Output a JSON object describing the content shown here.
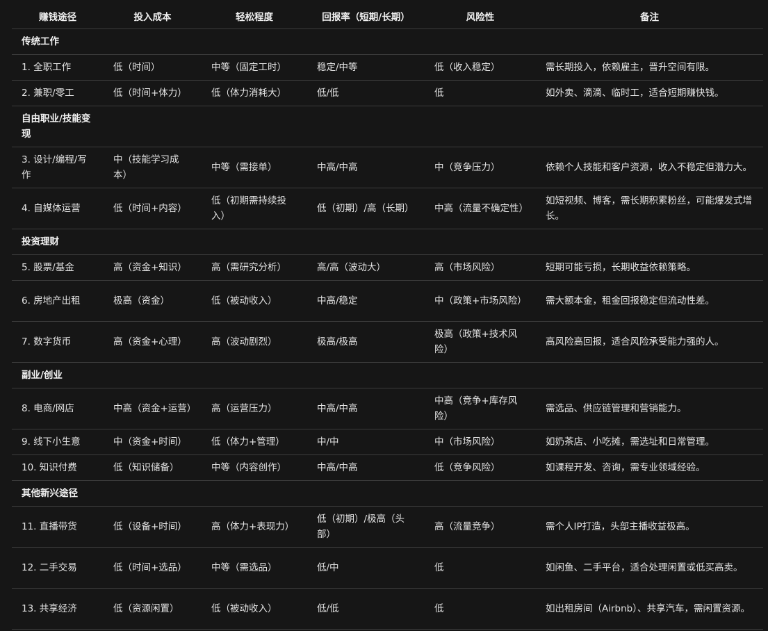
{
  "headers": [
    "赚钱途径",
    "投入成本",
    "轻松程度",
    "回报率（短期/长期）",
    "风险性",
    "备注"
  ],
  "sections": {
    "s1": "传统工作",
    "s2": "自由职业/技能变现",
    "s3": "投资理财",
    "s4": "副业/创业",
    "s5": "其他新兴途径"
  },
  "rows": {
    "r1": [
      "1. 全职工作",
      "低（时间）",
      "中等（固定工时）",
      "稳定/中等",
      "低（收入稳定）",
      "需长期投入，依赖雇主，晋升空间有限。"
    ],
    "r2": [
      "2. 兼职/零工",
      "低（时间+体力）",
      "低（体力消耗大）",
      "低/低",
      "低",
      "如外卖、滴滴、临时工，适合短期赚快钱。"
    ],
    "r3": [
      "3. 设计/编程/写作",
      "中（技能学习成本）",
      "中等（需接单）",
      "中高/中高",
      "中（竞争压力）",
      "依赖个人技能和客户资源，收入不稳定但潜力大。"
    ],
    "r4": [
      "4. 自媒体运营",
      "低（时间+内容）",
      "低（初期需持续投入）",
      "低（初期）/高（长期）",
      "中高（流量不确定性）",
      "如短视频、博客，需长期积累粉丝，可能爆发式增长。"
    ],
    "r5": [
      "5. 股票/基金",
      "高（资金+知识）",
      "高（需研究分析）",
      "高/高（波动大）",
      "高（市场风险）",
      "短期可能亏损，长期收益依赖策略。"
    ],
    "r6": [
      "6. 房地产出租",
      "极高（资金）",
      "低（被动收入）",
      "中高/稳定",
      "中（政策+市场风险）",
      "需大额本金，租金回报稳定但流动性差。"
    ],
    "r7": [
      "7. 数字货币",
      "高（资金+心理）",
      "高（波动剧烈）",
      "极高/极高",
      "极高（政策+技术风险）",
      "高风险高回报，适合风险承受能力强的人。"
    ],
    "r8": [
      "8. 电商/网店",
      "中高（资金+运营）",
      "高（运营压力）",
      "中高/中高",
      "中高（竞争+库存风险）",
      "需选品、供应链管理和营销能力。"
    ],
    "r9": [
      "9. 线下小生意",
      "中（资金+时间）",
      "低（体力+管理）",
      "中/中",
      "中（市场风险）",
      "如奶茶店、小吃摊，需选址和日常管理。"
    ],
    "r10": [
      "10. 知识付费",
      "低（知识储备）",
      "中等（内容创作）",
      "中高/中高",
      "低（竞争风险）",
      "如课程开发、咨询，需专业领域经验。"
    ],
    "r11": [
      "11. 直播带货",
      "低（设备+时间）",
      "高（体力+表现力）",
      "低（初期）/极高（头部）",
      "高（流量竞争）",
      "需个人IP打造，头部主播收益极高。"
    ],
    "r12": [
      "12. 二手交易",
      "低（时间+选品）",
      "中等（需选品）",
      "低/中",
      "低",
      "如闲鱼、二手平台，适合处理闲置或低买高卖。"
    ],
    "r13": [
      "13. 共享经济",
      "低（资源闲置）",
      "低（被动收入）",
      "低/低",
      "低",
      "如出租房间（Airbnb）、共享汽车，需闲置资源。"
    ]
  }
}
